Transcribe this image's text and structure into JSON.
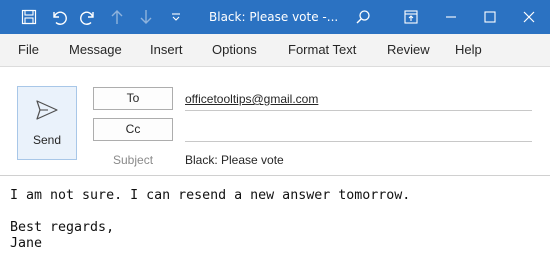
{
  "window": {
    "title": "Black: Please vote  -...",
    "colors": {
      "titlebar": "#2b72c2",
      "menubar": "#f3f3f3"
    },
    "toolbar_icons": [
      "save-icon",
      "undo-icon",
      "redo-icon",
      "up-arrow-icon",
      "down-arrow-icon",
      "customize-toolbar-icon",
      "search-icon",
      "ribbon-display-options-icon",
      "minimize-icon",
      "maximize-icon",
      "close-icon"
    ]
  },
  "menu": {
    "items": [
      "File",
      "Message",
      "Insert",
      "Options",
      "Format Text",
      "Review",
      "Help"
    ]
  },
  "compose": {
    "send_label": "Send",
    "to_button": "To",
    "cc_button": "Cc",
    "to_value": "officetooltips@gmail.com",
    "cc_value": "",
    "subject_label": "Subject",
    "subject_value": "Black: Please vote"
  },
  "body": {
    "line1": "I am not sure. I can resend a new answer tomorrow.",
    "line2": "Best regards,",
    "line3": "Jane"
  }
}
